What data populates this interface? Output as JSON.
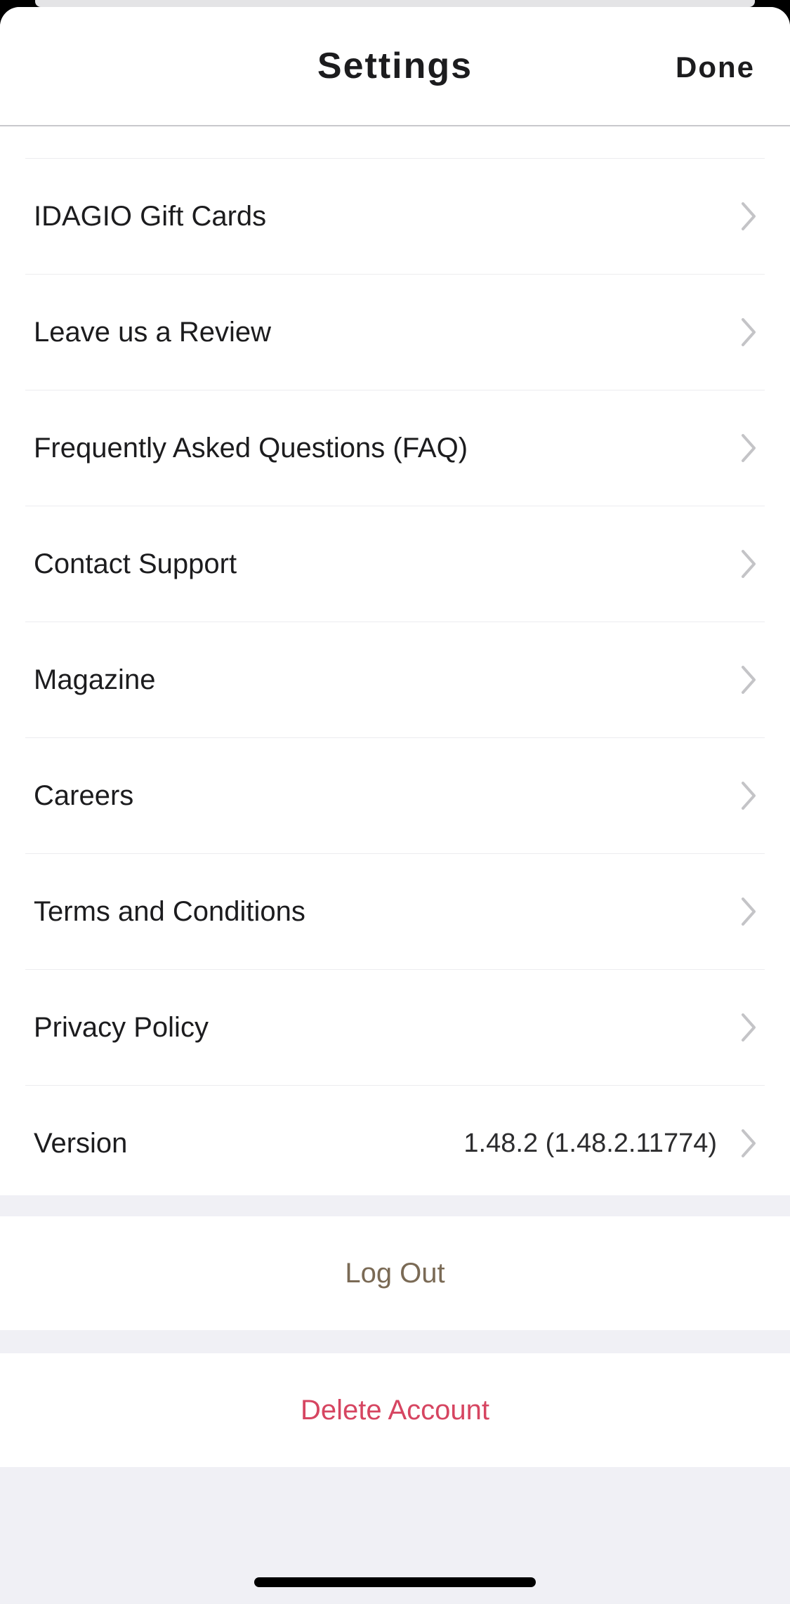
{
  "header": {
    "title": "Settings",
    "done_label": "Done"
  },
  "menu": {
    "items": [
      {
        "label": "IDAGIO Gift Cards",
        "icon": "chevron-right-icon"
      },
      {
        "label": "Leave us a Review",
        "icon": "chevron-right-icon"
      },
      {
        "label": "Frequently Asked Questions (FAQ)",
        "icon": "chevron-right-icon"
      },
      {
        "label": "Contact Support",
        "icon": "chevron-right-icon"
      },
      {
        "label": "Magazine",
        "icon": "chevron-right-icon"
      },
      {
        "label": "Careers",
        "icon": "chevron-right-icon"
      },
      {
        "label": "Terms and Conditions",
        "icon": "chevron-right-icon"
      },
      {
        "label": "Privacy Policy",
        "icon": "chevron-right-icon"
      },
      {
        "label": "Version",
        "value": "1.48.2 (1.48.2.11774)",
        "icon": "chevron-right-icon"
      }
    ]
  },
  "actions": {
    "logout_label": "Log Out",
    "delete_label": "Delete Account"
  },
  "colors": {
    "logout": "#7a6a55",
    "delete": "#d64561",
    "chevron": "#c4c4c7",
    "background": "#f0f0f5"
  }
}
